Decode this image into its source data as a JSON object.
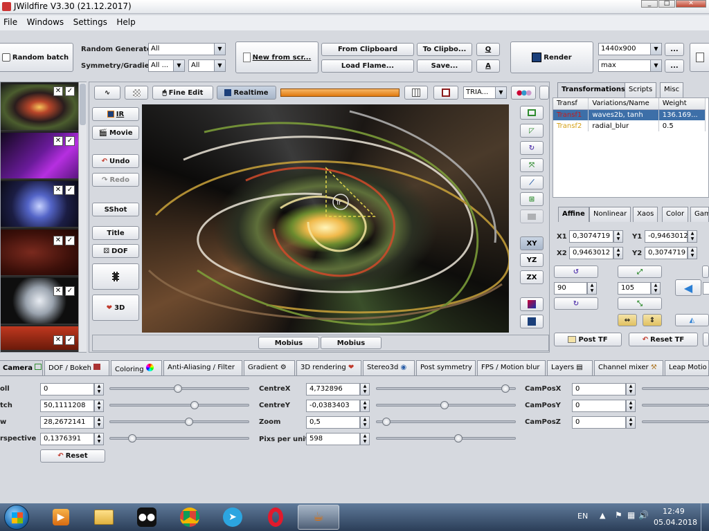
{
  "window": {
    "title": "JWildfire V3.30 (21.12.2017)",
    "controls": {
      "minimize": "_",
      "maximize": "□",
      "close": "✕"
    }
  },
  "menu": [
    "File",
    "Windows",
    "Settings",
    "Help"
  ],
  "toolbar": {
    "random_batch": "Random batch",
    "random_generator_label": "Random Generator",
    "random_generator_value": "All",
    "symmetry_label": "Symmetry/Gradient",
    "symmetry_value": "All ...",
    "gradient_value": "All",
    "new_from_scratch": "New from scr...",
    "from_clipboard": "From Clipboard",
    "load_flame": "Load Flame...",
    "to_clipboard": "To Clipbo...",
    "save": "Save...",
    "q": "Q",
    "a": "A",
    "render": "Render",
    "resolution": "1440x900",
    "quality": "max",
    "ellipsis": "..."
  },
  "preview_toolbar": {
    "fine_edit": "Fine Edit",
    "realtime": "Realtime",
    "triangle_mode": "TRIA..."
  },
  "left_buttons": {
    "ir": "IR",
    "movie": "Movie",
    "undo": "Undo",
    "redo": "Redo",
    "sshot": "SShot",
    "title": "Title",
    "dof": "DOF",
    "three_d": "3D"
  },
  "right_icons": {
    "xy": "XY",
    "yz": "YZ",
    "zx": "ZX"
  },
  "bottom_preview": {
    "mobius1": "Mobius",
    "mobius2": "Mobius"
  },
  "preview_overlay": {
    "transform_marker": "Tr"
  },
  "right_tabs": {
    "transformations": "Transformations",
    "scripts": "Scripts",
    "misc": "Misc"
  },
  "transform_table": {
    "headers": [
      "Transf",
      "Variations/Name",
      "Weight"
    ],
    "rows": [
      {
        "transf": "Transf1",
        "name": "waves2b, tanh",
        "weight": "136.169..."
      },
      {
        "transf": "Transf2",
        "name": "radial_blur",
        "weight": "0.5"
      }
    ]
  },
  "affine_tabs": {
    "affine": "Affine",
    "nonlinear": "Nonlinear",
    "xaos": "Xaos",
    "color": "Color",
    "gamma": "Gam"
  },
  "affine": {
    "x1_label": "X1",
    "x1": "0,3074719",
    "y1_label": "Y1",
    "y1": "-0,9463012",
    "x2_label": "X2",
    "x2": "0,9463012",
    "y2_label": "Y2",
    "y2": "0,3074719",
    "rotate": "90",
    "scale": "105",
    "post_tf": "Post TF",
    "reset_tf": "Reset TF"
  },
  "bottom_tabs": [
    "Camera",
    "DOF / Bokeh",
    "Coloring",
    "Anti-Aliasing / Filter",
    "Gradient",
    "3D rendering",
    "Stereo3d",
    "Post symmetry",
    "FPS / Motion blur",
    "Layers",
    "Channel mixer",
    "Leap Motio"
  ],
  "camera": {
    "roll_label": "oll",
    "roll": "0",
    "pitch_label": "tch",
    "pitch": "50,1111208",
    "yaw_label": "w",
    "yaw": "28,2672141",
    "perspective_label": "rspective",
    "perspective": "0,1376391",
    "reset": "Reset",
    "centrex_label": "CentreX",
    "centrex": "4,732896",
    "centrey_label": "CentreY",
    "centrey": "-0,0383403",
    "zoom_label": "Zoom",
    "zoom": "0,5",
    "pixs_label": "Pixs per unit",
    "pixs": "598",
    "camposx_label": "CamPosX",
    "camposx": "0",
    "camposy_label": "CamPosY",
    "camposy": "0",
    "camposz_label": "CamPosZ",
    "camposz": "0"
  },
  "sliders": {
    "roll": 0.49,
    "pitch": 0.61,
    "yaw": 0.57,
    "perspective": 0.16,
    "centrex": 0.93,
    "centrey": 0.49,
    "zoom": 0.07,
    "pixs": 0.59
  },
  "taskbar": {
    "lang": "EN",
    "time": "12:49",
    "date": "05.04.2018"
  },
  "colors": {
    "accent": "#3d6fa8",
    "progress": "#f08a1c",
    "transf1": "#c41e1e",
    "transf2": "#d4a017"
  }
}
